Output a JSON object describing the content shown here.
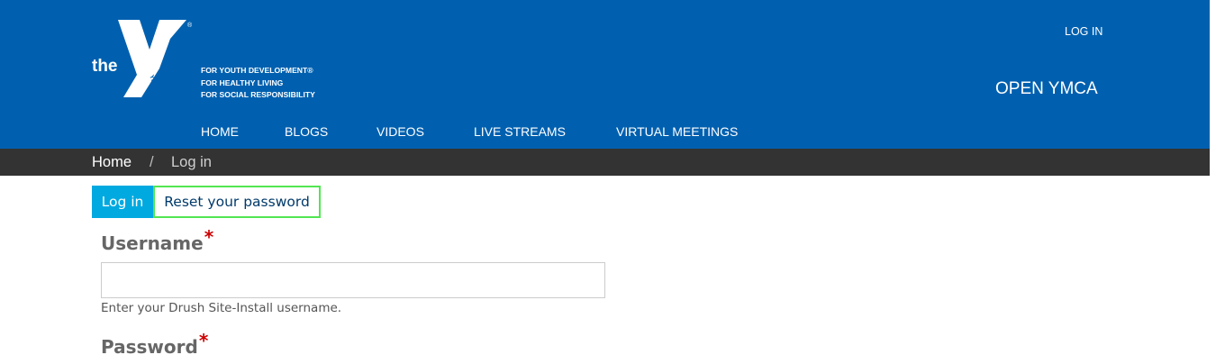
{
  "header": {
    "logo": {
      "word": "the",
      "badge": "YMCA"
    },
    "tagline": [
      "FOR YOUTH DEVELOPMENT®",
      "FOR HEALTHY LIVING",
      "FOR SOCIAL RESPONSIBILITY"
    ],
    "login_link": "LOG IN",
    "site_name": "OPEN YMCA",
    "nav": [
      {
        "label": "HOME"
      },
      {
        "label": "BLOGS"
      },
      {
        "label": "VIDEOS"
      },
      {
        "label": "LIVE STREAMS"
      },
      {
        "label": "VIRTUAL MEETINGS"
      }
    ],
    "colors": {
      "header_bg": "#0060af",
      "breadcrumb_bg": "#333333",
      "tab_active": "#00a9e0"
    }
  },
  "breadcrumb": {
    "home": "Home",
    "separator": "/",
    "current": "Log in"
  },
  "tabs": {
    "login": "Log in",
    "reset": "Reset your password"
  },
  "form": {
    "username_label": "Username",
    "username_value": "",
    "username_help": "Enter your Drush Site-Install username.",
    "password_label": "Password",
    "required_mark": "*"
  }
}
